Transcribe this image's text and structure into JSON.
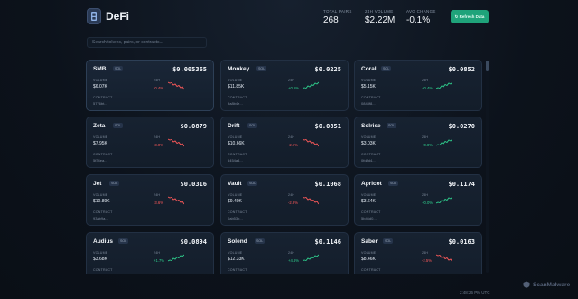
{
  "app": {
    "title": "DeFi"
  },
  "stats": [
    {
      "label": "TOTAL PAIRS",
      "value": "268"
    },
    {
      "label": "24H VOLUME",
      "value": "$2.22M"
    },
    {
      "label": "AVG CHANGE",
      "value": "-0.1%"
    }
  ],
  "refresh_label": "↻ Refresh Data",
  "search": {
    "placeholder": "Search tokens, pairs, or contracts..."
  },
  "labels": {
    "volume": "VOLUME",
    "change": "24H",
    "contract": "CONTRACT"
  },
  "colors": {
    "accent": "#1fa37a",
    "up": "#2fd08e",
    "down": "#ff5a5a"
  },
  "cards": [
    {
      "name": "SMB",
      "chain": "SOL",
      "price": "$0.005365",
      "volume": "$6.07K",
      "change": "-0.4%",
      "trend": "down",
      "contract": "5776bt..."
    },
    {
      "name": "Monkey",
      "chain": "SOL",
      "price": "$0.0225",
      "volume": "$11.85K",
      "change": "+0.5%",
      "trend": "up",
      "contract": "9a8b4e..."
    },
    {
      "name": "Coral",
      "chain": "SOL",
      "price": "$0.0852",
      "volume": "$5.15K",
      "change": "+0.4%",
      "trend": "up",
      "contract": "0843f8..."
    },
    {
      "name": "Zeta",
      "chain": "SOL",
      "price": "$0.0879",
      "volume": "$7.95K",
      "change": "-3.0%",
      "trend": "down",
      "contract": "5f34ea..."
    },
    {
      "name": "Drift",
      "chain": "SOL",
      "price": "$0.0851",
      "volume": "$10.66K",
      "change": "-2.1%",
      "trend": "down",
      "contract": "5454a4..."
    },
    {
      "name": "Solrise",
      "chain": "SOL",
      "price": "$0.0270",
      "volume": "$3.03K",
      "change": "+0.8%",
      "trend": "up",
      "contract": "0fd8d4..."
    },
    {
      "name": "Jet",
      "chain": "SOL",
      "price": "$0.0316",
      "volume": "$10.89K",
      "change": "-3.6%",
      "trend": "down",
      "contract": "93ab9a..."
    },
    {
      "name": "Vault",
      "chain": "SOL",
      "price": "$0.1068",
      "volume": "$9.40K",
      "change": "-2.8%",
      "trend": "down",
      "contract": "0ab53b..."
    },
    {
      "name": "Apricot",
      "chain": "SOL",
      "price": "$0.1174",
      "volume": "$3.64K",
      "change": "+0.0%",
      "trend": "up",
      "contract": "5b46d0..."
    },
    {
      "name": "Audius",
      "chain": "SOL",
      "price": "$0.0894",
      "volume": "$3.68K",
      "change": "+1.7%",
      "trend": "up",
      "contract": ""
    },
    {
      "name": "Solend",
      "chain": "SOL",
      "price": "$0.1146",
      "volume": "$12.33K",
      "change": "+4.6%",
      "trend": "up",
      "contract": ""
    },
    {
      "name": "Saber",
      "chain": "SOL",
      "price": "$0.0163",
      "volume": "$8.46K",
      "change": "-2.5%",
      "trend": "down",
      "contract": ""
    }
  ],
  "footer": {
    "time": "2:48:26 PM UTC"
  },
  "watermark": {
    "text": "ScanMalware"
  }
}
